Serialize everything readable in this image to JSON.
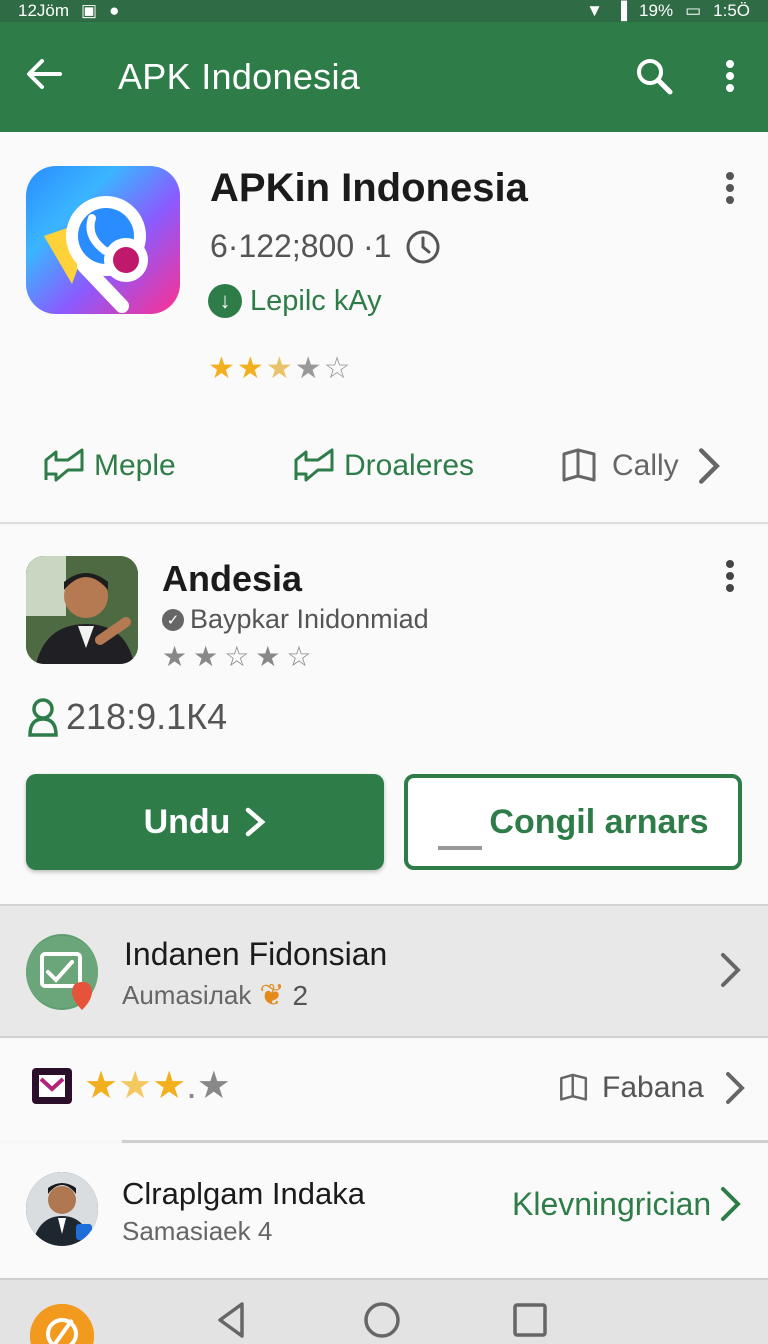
{
  "status_bar": {
    "time": "12Jöm",
    "battery": "19%",
    "clock": "1:5Ö"
  },
  "app_bar": {
    "title": "APK Indonesia"
  },
  "app": {
    "name": "APKin Indonesia",
    "meta": "6·122;800 ·1",
    "developer": "Lepilc kAy",
    "rating_stars": 2.5,
    "stars_display": "★★★★☆"
  },
  "actions": [
    {
      "label": "Meple"
    },
    {
      "label": "Droaleres"
    },
    {
      "label": "Cally"
    }
  ],
  "publisher": {
    "name": "Andesia",
    "subtitle": "Baypkar Inidonmiad",
    "stars_display": "★★☆★☆",
    "downloads": "218:9.1К4"
  },
  "buttons": {
    "primary": "Undu",
    "secondary": "Congil arnars"
  },
  "rows": {
    "first": {
      "title": "Indanen Fidonsian",
      "subtitle": "Aumasiлаk",
      "count": "2"
    },
    "second": {
      "stars_display": "★★★★",
      "label": "Fabana"
    },
    "third": {
      "title": "Clraplgam Indaka",
      "subtitle": "Samasiaek 4",
      "link": "Klevningrician"
    }
  },
  "colors": {
    "brand": "#2e7d49",
    "star": "#f2b01e"
  }
}
